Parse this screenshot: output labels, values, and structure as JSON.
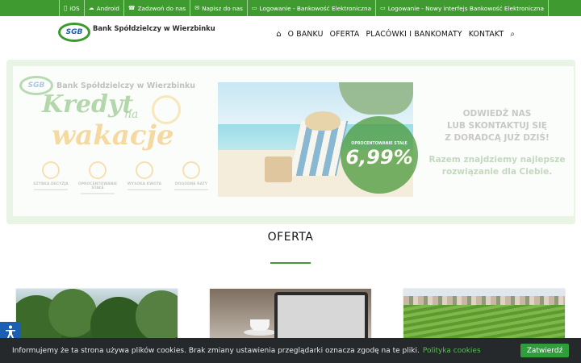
{
  "topbar": {
    "items": [
      {
        "icon": "apple-icon",
        "glyph": "",
        "label": "iOS"
      },
      {
        "icon": "android-icon",
        "glyph": "☁",
        "label": "Android"
      },
      {
        "icon": "phone-icon",
        "glyph": "☎",
        "label": "Zadzwoń do nas"
      },
      {
        "icon": "envelope-icon",
        "glyph": "✉",
        "label": "Napisz do nas"
      },
      {
        "icon": "monitor-icon",
        "glyph": "▭",
        "label": "Logowanie - Bankowość Elektroniczna"
      },
      {
        "icon": "monitor-icon",
        "glyph": "▭",
        "label": "Logowanie - Nowy interfejs Bankowość Elektroniczna"
      }
    ]
  },
  "header": {
    "logo_mark": "SGB",
    "logo_name": "Bank Spółdzielczy w Wierzbinku",
    "nav": {
      "home_icon": "⌂",
      "items": [
        "O BANKU",
        "OFERTA",
        "PLACÓWKI I BANKOMATY",
        "KONTAKT"
      ],
      "search_icon": "⌕"
    }
  },
  "banner": {
    "logo_mark": "SGB",
    "logo_name": "Bank Spółdzielczy w Wierzbinku",
    "headline_1": "Kredyt",
    "headline_na": "na",
    "headline_2": "wakacje",
    "features": [
      "Szybka decyzja",
      "Oprocentowanie stałe",
      "Wysoka kwota",
      "Dogodne raty"
    ],
    "badge_text": "oprocentowanie stałe",
    "badge_value": "6,99%",
    "cta_line_1": "ODWIEDŹ NAS",
    "cta_line_2": "LUB SKONTAKTUJ SIĘ",
    "cta_line_3": "Z DORADCĄ JUŻ DZIŚ!",
    "cta_sub_1": "Razem znajdziemy najlepsze",
    "cta_sub_2": "rozwiązanie dla Ciebie."
  },
  "section": {
    "title": "OFERTA"
  },
  "cookie": {
    "text": "Informujemy że ta strona używa plików cookies. Brak zmiany ustawienia przeglądarki oznacza zgodę na te pliki.",
    "link": "Polityka cookies",
    "button": "Zatwierdź"
  },
  "accessibility": {
    "icon": "♿"
  },
  "colors": {
    "brand_green": "#3f9b30",
    "cookie_bg": "#26292c",
    "accessibility_blue": "#1b5fb3"
  }
}
